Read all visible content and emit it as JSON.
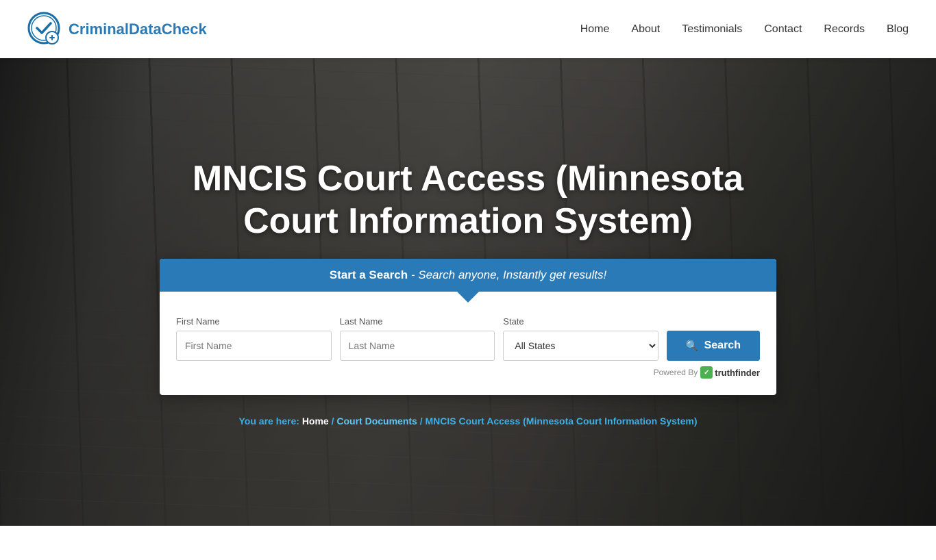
{
  "header": {
    "logo_brand": "Criminal",
    "logo_brand_accent": "DataCheck",
    "nav": [
      {
        "label": "Home",
        "id": "home"
      },
      {
        "label": "About",
        "id": "about"
      },
      {
        "label": "Testimonials",
        "id": "testimonials"
      },
      {
        "label": "Contact",
        "id": "contact"
      },
      {
        "label": "Records",
        "id": "records"
      },
      {
        "label": "Blog",
        "id": "blog"
      }
    ]
  },
  "hero": {
    "title": "MNCIS Court Access (Minnesota Court Information System)",
    "search_bar_label_bold": "Start a Search",
    "search_bar_label_italic": "- Search anyone, Instantly get results!",
    "fields": {
      "first_name_label": "First Name",
      "first_name_placeholder": "First Name",
      "last_name_label": "Last Name",
      "last_name_placeholder": "Last Name",
      "state_label": "State",
      "state_default": "All States"
    },
    "search_button_label": "Search",
    "powered_by_label": "Powered By",
    "powered_by_brand": "truthfinder"
  },
  "breadcrumb": {
    "prefix": "You are here: ",
    "home": "Home",
    "separator1": " / ",
    "court_docs": "Court Documents",
    "separator2": " / ",
    "current": "MNCIS Court Access (Minnesota Court Information System)"
  }
}
